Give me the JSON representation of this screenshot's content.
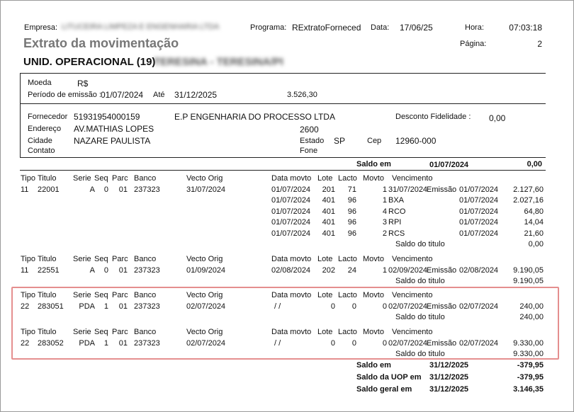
{
  "header": {
    "empresa_label": "Empresa:",
    "empresa_value": "LITUCEIRA LIMPEZA E ENGENHARIA LTDA",
    "programa_label": "Programa:",
    "programa_value": "RExtratoForneced",
    "data_label": "Data:",
    "data_value": "17/06/25",
    "hora_label": "Hora:",
    "hora_value": "07:03:18",
    "title": "Extrato da movimentação",
    "pagina_label": "Página:",
    "pagina_value": "2",
    "unidade_label": "UNID. OPERACIONAL (19)",
    "unidade_value": "TERESINA - TERESINA/PI"
  },
  "params": {
    "moeda_label": "Moeda",
    "moeda_value": "R$",
    "periodo_label": "Período de emissão :",
    "periodo_inicio": "01/07/2024",
    "ate_label": "Até",
    "periodo_fim": "31/12/2025",
    "valor": "3.526,30"
  },
  "supplier": {
    "fornecedor_label": "Fornecedor",
    "fornecedor_doc": "51931954000159",
    "fornecedor_nome": "E.P ENGENHARIA DO PROCESSO LTDA",
    "desconto_label": "Desconto Fidelidade :",
    "desconto_value": "0,00",
    "endereco_label": "Endereço",
    "endereco_value": "AV.MATHIAS LOPES",
    "numero": "2600",
    "cidade_label": "Cidade",
    "cidade_value": "NAZARE PAULISTA",
    "estado_label": "Estado",
    "estado_value": "SP",
    "cep_label": "Cep",
    "cep_value": "12960-000",
    "contato_label": "Contato",
    "fone_label": "Fone"
  },
  "saldo_inicial": {
    "label": "Saldo em",
    "date": "01/07/2024",
    "value": "0,00"
  },
  "columns": {
    "tipo": "Tipo",
    "titulo": "Titulo",
    "serie": "Serie",
    "seq": "Seq",
    "parc": "Parc",
    "banco": "Banco",
    "vecto": "Vecto Orig",
    "data_movto": "Data movto",
    "lote": "Lote",
    "lacto": "Lacto",
    "movto": "Movto",
    "vencimento": "Vencimento"
  },
  "titles": [
    {
      "tipo": "11",
      "titulo": "22001",
      "serie": "A",
      "seq": "0",
      "parc": "01",
      "banco": "237323",
      "vecto": "31/07/2024",
      "movs": [
        {
          "data": "01/07/2024",
          "lote": "201",
          "lacto": "71",
          "movto": "1",
          "venc": "31/07/2024",
          "desc": "Emissão",
          "desc_date": "01/07/2024",
          "valor": "2.127,60"
        },
        {
          "data": "01/07/2024",
          "lote": "401",
          "lacto": "96",
          "movto": "1",
          "venc": "BXA",
          "desc": "",
          "desc_date": "01/07/2024",
          "valor": "2.027,16"
        },
        {
          "data": "01/07/2024",
          "lote": "401",
          "lacto": "96",
          "movto": "4",
          "venc": "RCO",
          "desc": "",
          "desc_date": "01/07/2024",
          "valor": "64,80"
        },
        {
          "data": "01/07/2024",
          "lote": "401",
          "lacto": "96",
          "movto": "3",
          "venc": "RPI",
          "desc": "",
          "desc_date": "01/07/2024",
          "valor": "14,04"
        },
        {
          "data": "01/07/2024",
          "lote": "401",
          "lacto": "96",
          "movto": "2",
          "venc": "RCS",
          "desc": "",
          "desc_date": "01/07/2024",
          "valor": "21,60"
        }
      ],
      "saldo_label": "Saldo do titulo",
      "saldo": "0,00"
    },
    {
      "tipo": "11",
      "titulo": "22551",
      "serie": "A",
      "seq": "0",
      "parc": "01",
      "banco": "237323",
      "vecto": "01/09/2024",
      "movs": [
        {
          "data": "02/08/2024",
          "lote": "202",
          "lacto": "24",
          "movto": "1",
          "venc": "02/09/2024",
          "desc": "Emissão",
          "desc_date": "02/08/2024",
          "valor": "9.190,05"
        }
      ],
      "saldo_label": "Saldo do titulo",
      "saldo": "9.190,05"
    },
    {
      "tipo": "22",
      "titulo": "283051",
      "serie": "PDA",
      "seq": "1",
      "parc": "01",
      "banco": "237323",
      "vecto": "02/07/2024",
      "movs": [
        {
          "data": "/ /",
          "lote": "0",
          "lacto": "0",
          "movto": "0",
          "venc": "02/07/2024",
          "desc": "Emissão",
          "desc_date": "02/07/2024",
          "valor": "240,00"
        }
      ],
      "saldo_label": "Saldo do titulo",
      "saldo": "240,00"
    },
    {
      "tipo": "22",
      "titulo": "283052",
      "serie": "PDA",
      "seq": "1",
      "parc": "01",
      "banco": "237323",
      "vecto": "02/07/2024",
      "movs": [
        {
          "data": "/ /",
          "lote": "0",
          "lacto": "0",
          "movto": "0",
          "venc": "02/07/2024",
          "desc": "Emissão",
          "desc_date": "02/07/2024",
          "valor": "9.330,00"
        }
      ],
      "saldo_label": "Saldo do titulo",
      "saldo": "9.330,00"
    }
  ],
  "totals": [
    {
      "label": "Saldo em",
      "date": "31/12/2025",
      "value": "-379,95"
    },
    {
      "label": "Saldo da UOP em",
      "date": "31/12/2025",
      "value": "-379,95"
    },
    {
      "label": "Saldo geral em",
      "date": "31/12/2025",
      "value": "3.146,35"
    }
  ]
}
